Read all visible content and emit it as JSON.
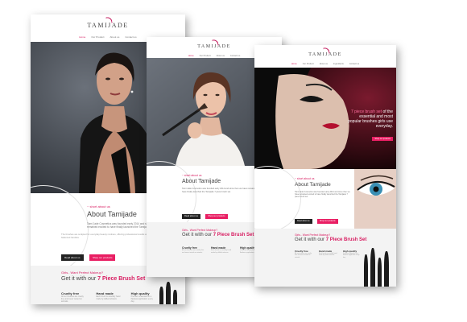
{
  "brand": {
    "logo": "TAMIJADE",
    "accent": "#e91e63"
  },
  "nav": {
    "items": [
      "Home",
      "Our Product",
      "About us",
      "Contact us"
    ],
    "items_sheet3": [
      "Home",
      "Our Product",
      "About us",
      "Ingredients",
      "Contact us"
    ]
  },
  "hero": {
    "tagline_pink": "7 piece brush set",
    "tagline_rest": "of the essential and most popular brushes girls use everyday."
  },
  "about": {
    "eyebrow": "~ short about us",
    "title": "About Tamijade",
    "text": "Tami Jade Cosmetics was founded early 2014 and since then we have remained excited to have finally launched the Tamijade 7 piece brush set.",
    "details": "The brushes are sculpted for everyday beauty routines, offering professional results with soft bristles and balanced handles.",
    "btn_more": "Read about us",
    "btn_shop": "Shop our products"
  },
  "promo": {
    "eyebrow": "Girls.. Want Perfect Makeup?",
    "title_pre": "Get it with our",
    "title_strong": "7 Piece Brush Set"
  },
  "features": [
    {
      "title": "Cruelty free",
      "text": "All our brushes are cruelty free and never tested on animals."
    },
    {
      "title": "Hand made",
      "text": "Each brush is carefully hand made by skilled artisans."
    },
    {
      "title": "High quality",
      "text": "Premium materials for a flawless application every day."
    }
  ]
}
